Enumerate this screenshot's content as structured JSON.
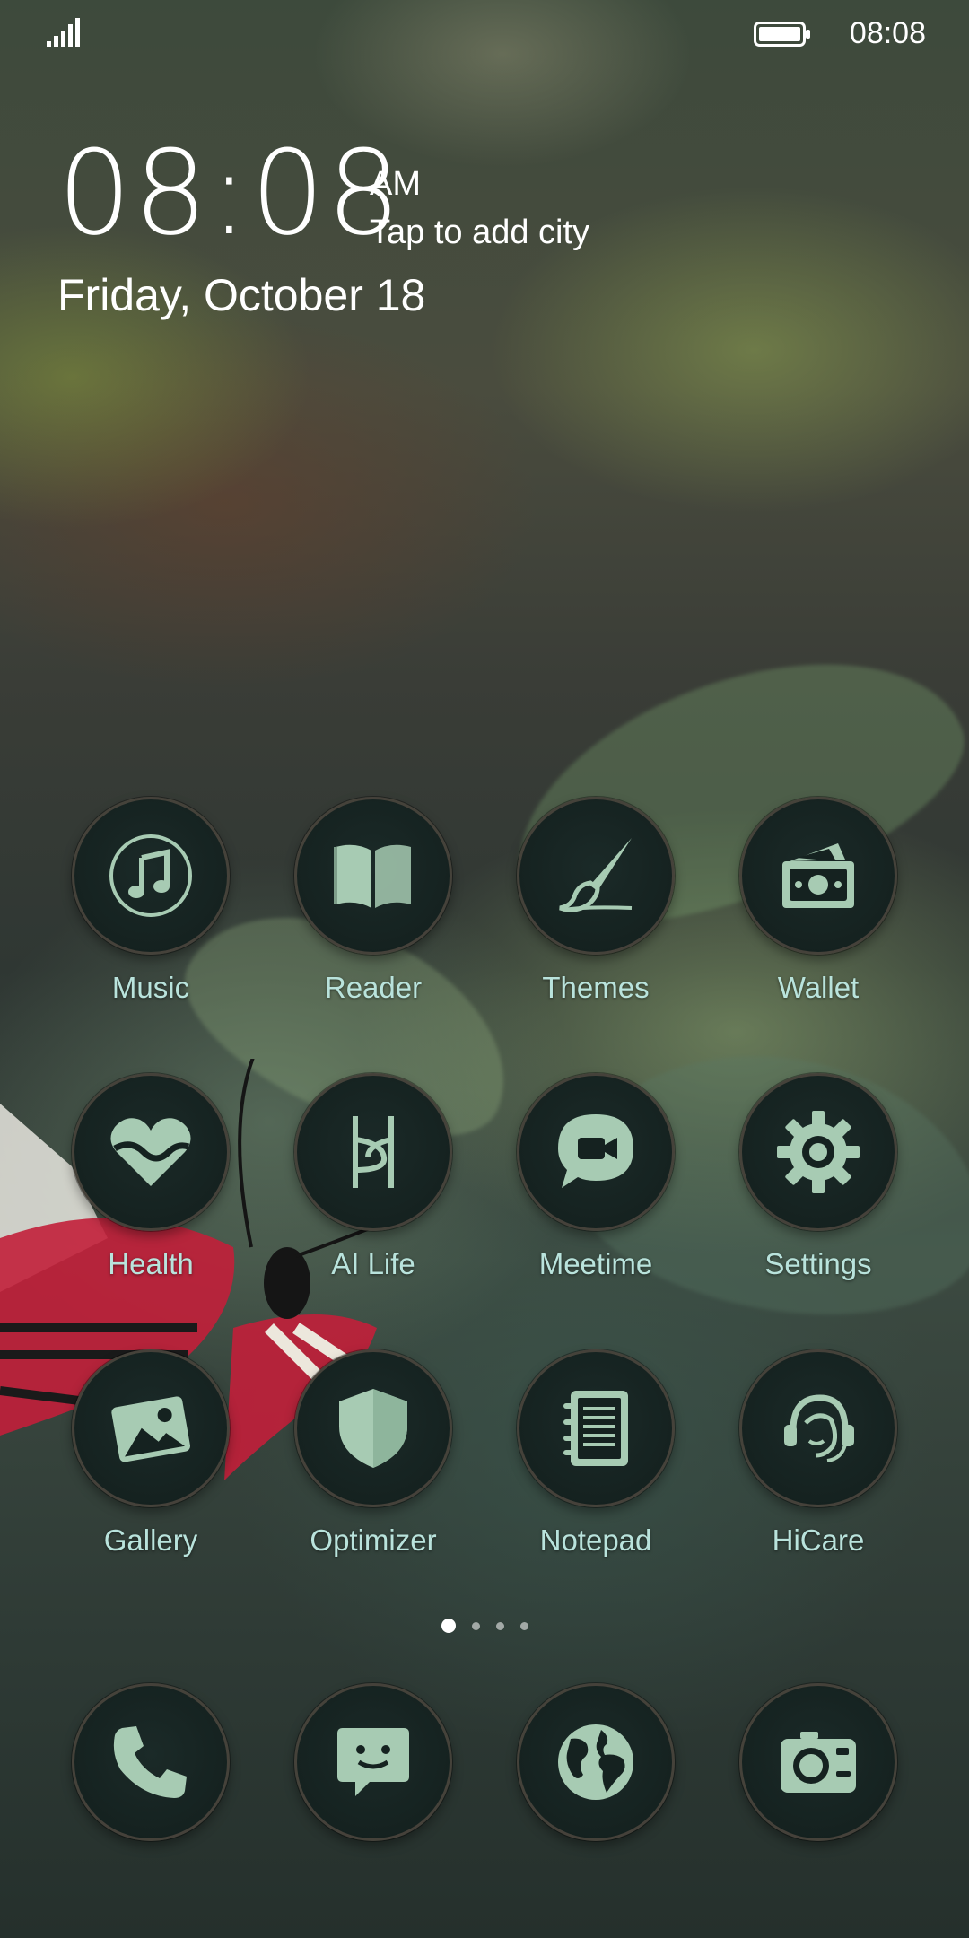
{
  "status_bar": {
    "time": "08:08"
  },
  "clock": {
    "time": "08:08",
    "ampm": "AM",
    "city_prompt": "Tap to add city",
    "date": "Friday, October 18"
  },
  "apps": [
    {
      "label": "Music",
      "icon": "music-icon"
    },
    {
      "label": "Reader",
      "icon": "book-icon"
    },
    {
      "label": "Themes",
      "icon": "paintbrush-icon"
    },
    {
      "label": "Wallet",
      "icon": "wallet-icon"
    },
    {
      "label": "Health",
      "icon": "heart-icon"
    },
    {
      "label": "AI Life",
      "icon": "ai-life-icon"
    },
    {
      "label": "Meetime",
      "icon": "video-chat-icon"
    },
    {
      "label": "Settings",
      "icon": "gear-icon"
    },
    {
      "label": "Gallery",
      "icon": "picture-icon"
    },
    {
      "label": "Optimizer",
      "icon": "shield-icon"
    },
    {
      "label": "Notepad",
      "icon": "notepad-icon"
    },
    {
      "label": "HiCare",
      "icon": "headset-icon"
    }
  ],
  "dock": [
    {
      "name": "phone",
      "icon": "phone-icon"
    },
    {
      "name": "messages",
      "icon": "message-icon"
    },
    {
      "name": "browser",
      "icon": "globe-icon"
    },
    {
      "name": "camera",
      "icon": "camera-icon"
    }
  ],
  "pager": {
    "pages": 4,
    "current": 1
  },
  "colors": {
    "icon_fill": "#a7cbb3",
    "label": "#b9e3dc",
    "icon_bg": "#152220"
  }
}
